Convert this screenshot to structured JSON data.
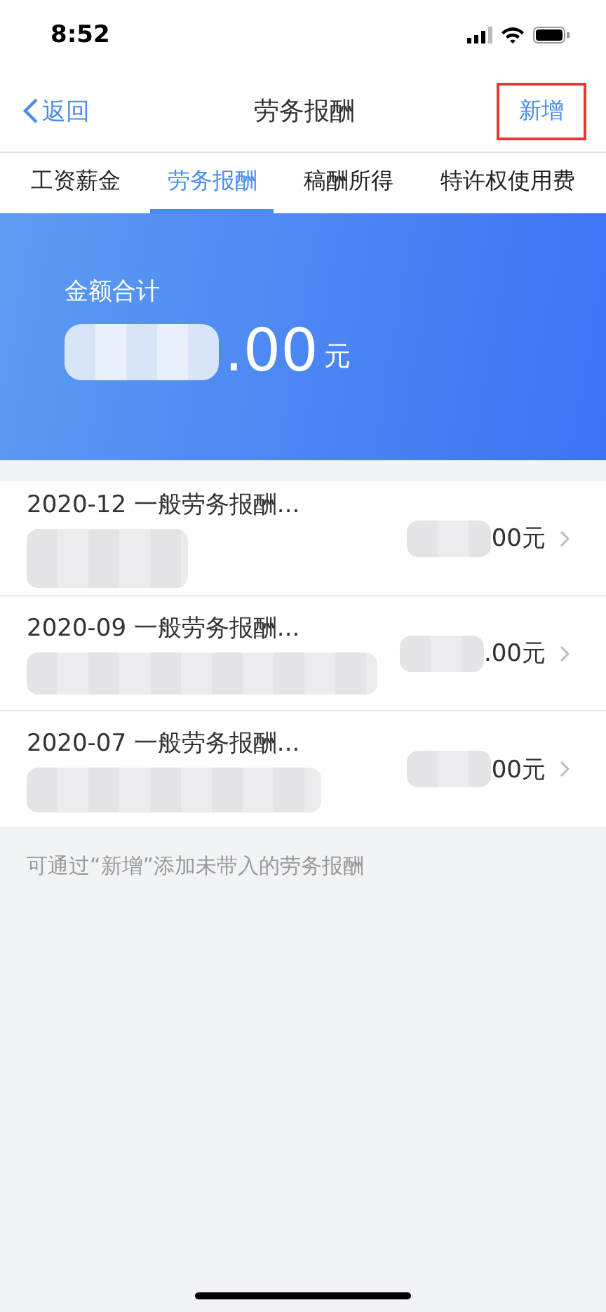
{
  "status_bar": {
    "time": "8:52"
  },
  "nav": {
    "back": "返回",
    "title": "劳务报酬",
    "action": "新增",
    "action_highlighted": true
  },
  "tabs": [
    {
      "label": "工资薪金",
      "selected": false
    },
    {
      "label": "劳务报酬",
      "selected": true
    },
    {
      "label": "稿酬所得",
      "selected": false
    },
    {
      "label": "特许权使用费",
      "selected": false
    }
  ],
  "summary": {
    "label": "金额合计",
    "amount": ".00",
    "unit": "元"
  },
  "records": [
    {
      "title": "2020-12 一般劳务报酬...",
      "amount": "00元"
    },
    {
      "title": "2020-09 一般劳务报酬...",
      "amount": ".00元"
    },
    {
      "title": "2020-07 一般劳务报酬...",
      "amount": "00元"
    }
  ],
  "note": "可通过“新增”添加未带入的劳务报酬"
}
